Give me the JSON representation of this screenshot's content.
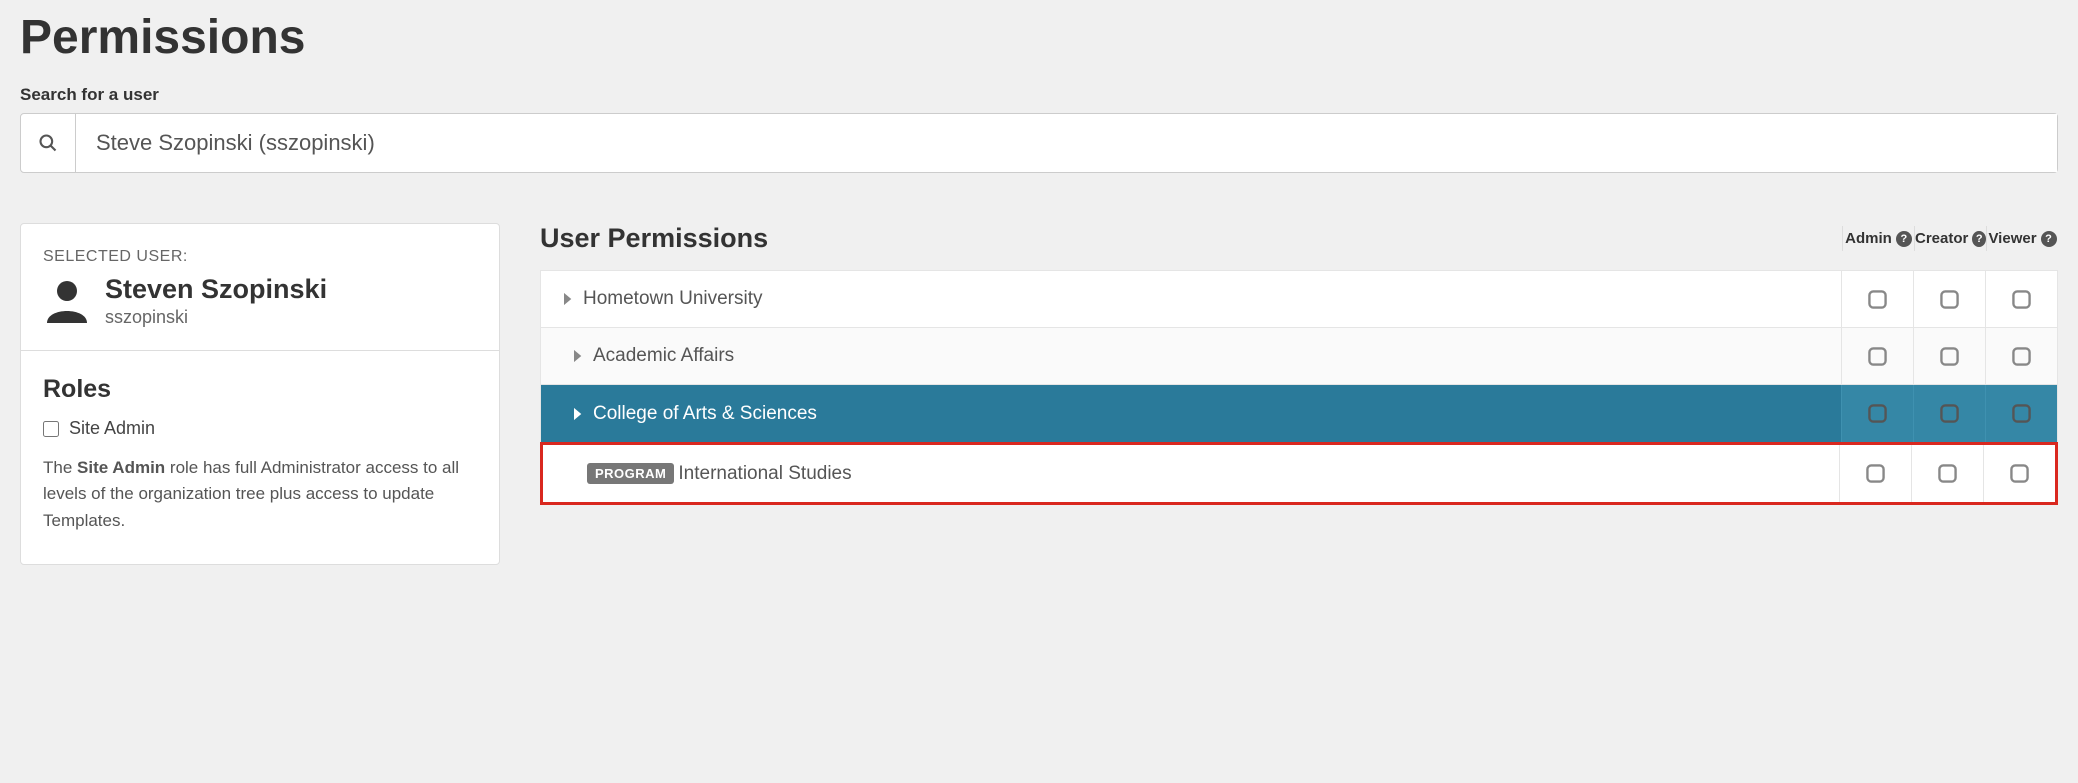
{
  "page_title": "Permissions",
  "search": {
    "label": "Search for a user",
    "value": "Steve Szopinski (sszopinski)"
  },
  "selected_user": {
    "heading": "SELECTED USER:",
    "name": "Steven Szopinski",
    "username": "sszopinski"
  },
  "roles": {
    "heading": "Roles",
    "site_admin_label": "Site Admin",
    "description_prefix": "The ",
    "description_bold": "Site Admin",
    "description_suffix": " role has full Administrator access to all levels of the organization tree plus access to update Templates."
  },
  "permissions": {
    "heading": "User Permissions",
    "columns": [
      "Admin",
      "Creator",
      "Viewer"
    ],
    "rows": [
      {
        "label": "Hometown University",
        "depth": 0,
        "expandable": true,
        "selected": false,
        "badge": null
      },
      {
        "label": "Academic Affairs",
        "depth": 1,
        "expandable": true,
        "selected": false,
        "badge": null
      },
      {
        "label": "College of Arts & Sciences",
        "depth": 2,
        "expandable": true,
        "selected": true,
        "badge": null
      },
      {
        "label": "International Studies",
        "depth": 3,
        "expandable": false,
        "selected": false,
        "badge": "PROGRAM",
        "highlighted": true
      }
    ]
  }
}
